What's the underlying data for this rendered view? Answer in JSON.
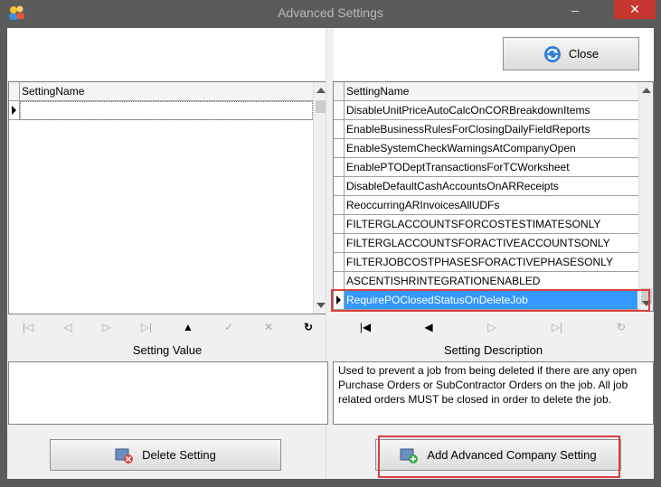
{
  "window": {
    "title": "Advanced Settings",
    "minimize_glyph": "‒",
    "close_glyph": "✕"
  },
  "toolbar": {
    "close_label": "Close"
  },
  "left_grid": {
    "header": "SettingName",
    "rows": [
      ""
    ]
  },
  "right_grid": {
    "header": "SettingName",
    "rows": [
      "DisableUnitPriceAutoCalcOnCORBreakdownItems",
      "EnableBusinessRulesForClosingDailyFieldReports",
      "EnableSystemCheckWarningsAtCompanyOpen",
      "EnablePTODeptTransactionsForTCWorksheet",
      "DisableDefaultCashAccountsOnARReceipts",
      "ReoccurringARInvoicesAllUDFs",
      "FILTERGLACCOUNTSFORCOSTESTIMATESONLY",
      "FILTERGLACCOUNTSFORACTIVEACCOUNTSONLY",
      "FILTERJOBCOSTPHASESFORACTIVEPHASESONLY",
      "ASCENTISHRINTEGRATIONENABLED",
      "RequirePOClosedStatusOnDeleteJob"
    ],
    "selected_index": 10
  },
  "setting_value": {
    "label": "Setting Value",
    "value": ""
  },
  "setting_description": {
    "label": "Setting Description",
    "text": "Used to prevent a job from being deleted if there are any open Purchase Orders or SubContractor Orders on the job.  All job related orders MUST be closed in order to delete the job."
  },
  "buttons": {
    "delete_label": "Delete Setting",
    "add_label": "Add Advanced Company Setting"
  },
  "colors": {
    "selection": "#3399ff",
    "highlight_border": "#d9413f",
    "titlebar": "#5b5b5b"
  }
}
